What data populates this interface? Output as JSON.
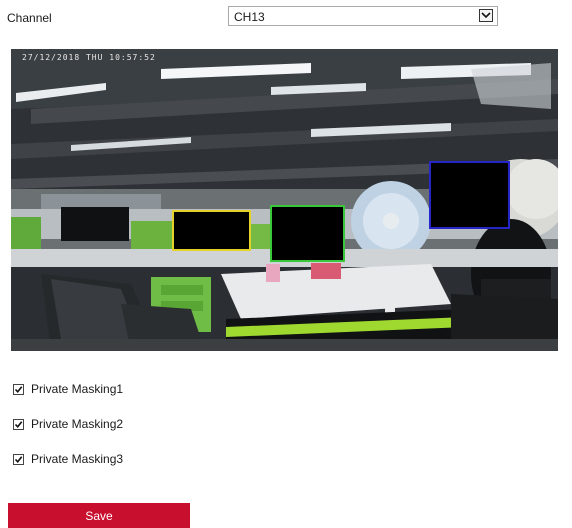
{
  "form": {
    "channel_label": "Channel",
    "channel_value": "CH13"
  },
  "video": {
    "osd_text": "27/12/2018 THU 10:57:52"
  },
  "masking": [
    {
      "label": "Private Masking1",
      "checked": true,
      "color": "#e4d12a"
    },
    {
      "label": "Private Masking2",
      "checked": true,
      "color": "#39c83a"
    },
    {
      "label": "Private Masking3",
      "checked": true,
      "color": "#2626c8"
    }
  ],
  "actions": {
    "save_label": "Save",
    "save_color": "#c8102e"
  }
}
